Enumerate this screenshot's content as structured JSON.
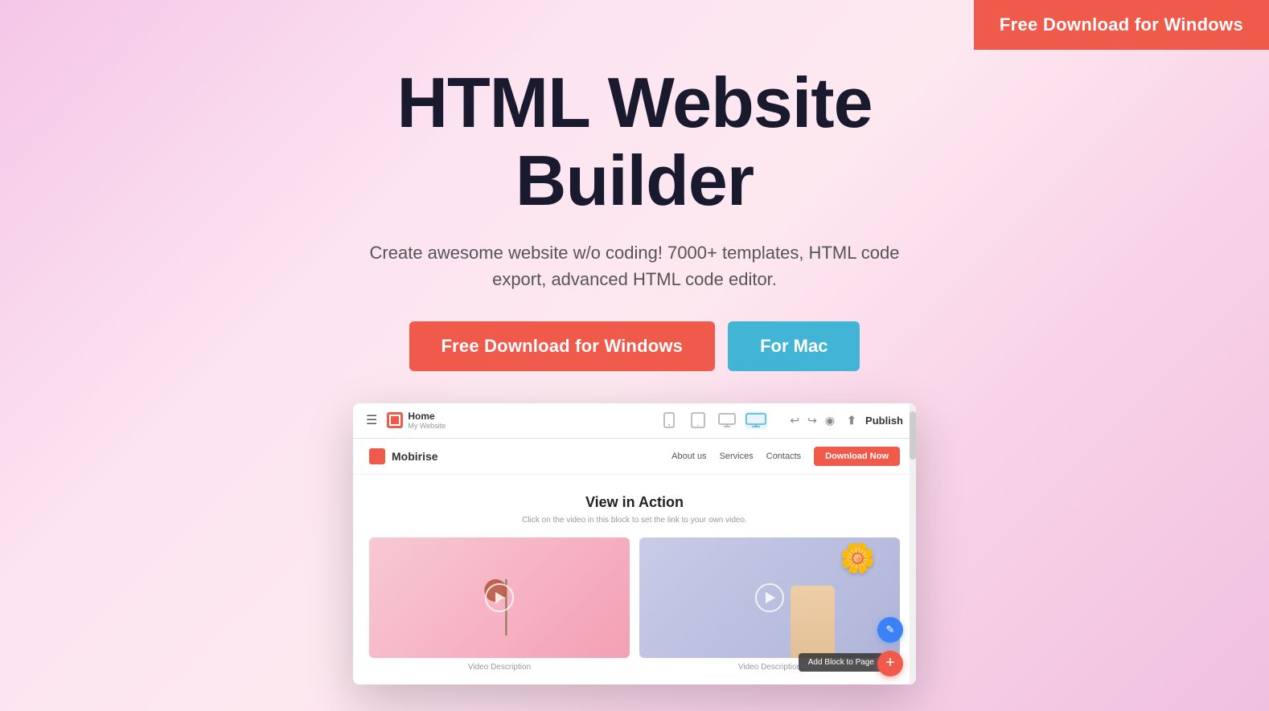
{
  "topCta": {
    "label": "Free Download for Windows"
  },
  "hero": {
    "title": "HTML Website\nBuilder",
    "subtitle": "Create awesome website w/o coding! 7000+ templates, HTML code export, advanced HTML code editor.",
    "btnWindows": "Free Download for Windows",
    "btnMac": "For Mac"
  },
  "appMockup": {
    "toolbar": {
      "menuIcon": "☰",
      "homeLabel": "Home",
      "homeSub": "My Website",
      "devices": [
        "mobile",
        "tablet",
        "small-desktop",
        "desktop"
      ],
      "activeDevice": 3,
      "undoIcon": "←",
      "redoIcon": "→",
      "previewIcon": "👁",
      "publishLabel": "Publish"
    },
    "siteNav": {
      "logoText": "Mobirise",
      "links": [
        "About us",
        "Services",
        "Contacts"
      ],
      "ctaBtn": "Download Now"
    },
    "videoSection": {
      "title": "View in Action",
      "subtitle": "Click on the video in this block to set the link to your own video.",
      "videos": [
        {
          "desc": "Video Description"
        },
        {
          "desc": "Video Description"
        }
      ]
    },
    "addBlockLabel": "Add Block to Page",
    "editIcon": "✎",
    "plusIcon": "+"
  },
  "icons": {
    "menu": "☰",
    "undo": "↩",
    "redo": "↪",
    "preview": "◉",
    "publish": "⬆",
    "pencil": "✎",
    "plus": "+"
  }
}
